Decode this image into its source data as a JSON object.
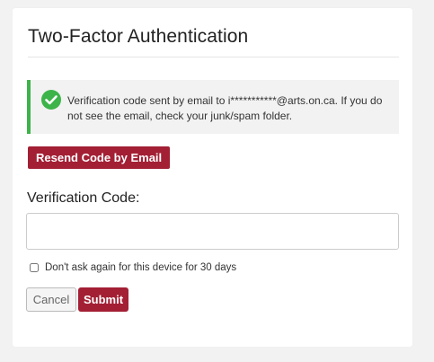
{
  "page": {
    "title": "Two-Factor Authentication"
  },
  "alert": {
    "icon": "check-circle-icon",
    "message": "Verification code sent by email to i***********@arts.on.ca. If you do not see the email, check your junk/spam folder.",
    "color": "#3cb449"
  },
  "resend": {
    "label": "Resend Code by Email"
  },
  "code": {
    "label": "Verification Code:",
    "value": "",
    "placeholder": ""
  },
  "remember": {
    "label": "Don't ask again for this device for 30 days",
    "checked": false
  },
  "actions": {
    "cancel_label": "Cancel",
    "submit_label": "Submit"
  },
  "colors": {
    "primary": "#a31f34",
    "success": "#3cb449",
    "background": "#f2f2f2"
  }
}
